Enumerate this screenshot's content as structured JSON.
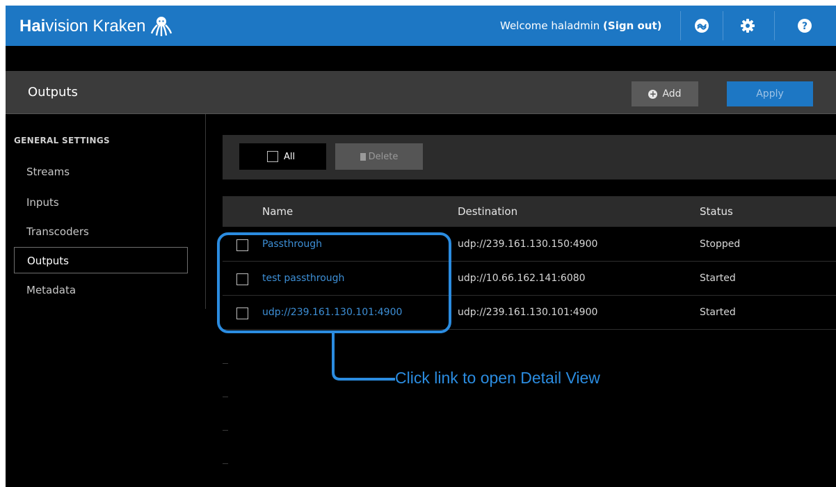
{
  "header": {
    "brand_bold": "Hai",
    "brand_rest": "vision Kraken",
    "welcome_text": "Welcome haladmin",
    "sign_out_label": "(Sign out)",
    "icons": [
      "octopus-logo-icon",
      "haivision-icon",
      "gear-icon",
      "help-icon"
    ]
  },
  "page": {
    "title": "Outputs",
    "add_label": "Add",
    "apply_label": "Apply"
  },
  "sidebar": {
    "section_title": "GENERAL SETTINGS",
    "items": [
      {
        "label": "Streams"
      },
      {
        "label": "Inputs"
      },
      {
        "label": "Transcoders"
      },
      {
        "label": "Outputs",
        "active": true
      },
      {
        "label": "Metadata"
      }
    ]
  },
  "toolbar": {
    "all_label": "All",
    "delete_label": "Delete"
  },
  "table": {
    "columns": [
      "Name",
      "Destination",
      "Status"
    ],
    "rows": [
      {
        "name": "Passthrough",
        "destination": "udp://239.161.130.150:4900",
        "status": "Stopped"
      },
      {
        "name": "test passthrough",
        "destination": "udp://10.66.162.141:6080",
        "status": "Started"
      },
      {
        "name": "udp://239.161.130.101:4900",
        "destination": "udp://239.161.130.101:4900",
        "status": "Started"
      }
    ]
  },
  "annotation": {
    "text": "Click link to open Detail View"
  },
  "colors": {
    "header_blue": "#1d77c4",
    "link_blue": "#3d8fd6",
    "callout_blue": "#2b8ce0",
    "background": "#000000"
  }
}
